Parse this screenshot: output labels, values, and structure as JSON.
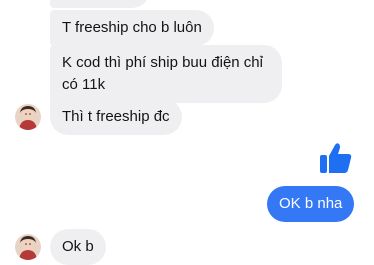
{
  "conversation": {
    "messages": [
      {
        "from": "other",
        "text": "T freeship cho b luôn"
      },
      {
        "from": "other",
        "text": "K cod thì phí ship buu điện chỉ có 11k"
      },
      {
        "from": "other",
        "text": "Thì t freeship đc"
      },
      {
        "from": "me",
        "type": "like",
        "icon": "thumbs-up-icon"
      },
      {
        "from": "me",
        "text": "OK b nha"
      },
      {
        "from": "other",
        "text": "Ok b"
      }
    ]
  },
  "colors": {
    "incoming_bubble": "#efeff1",
    "outgoing_bubble": "#3478f6",
    "like_icon": "#1f6ff2"
  }
}
